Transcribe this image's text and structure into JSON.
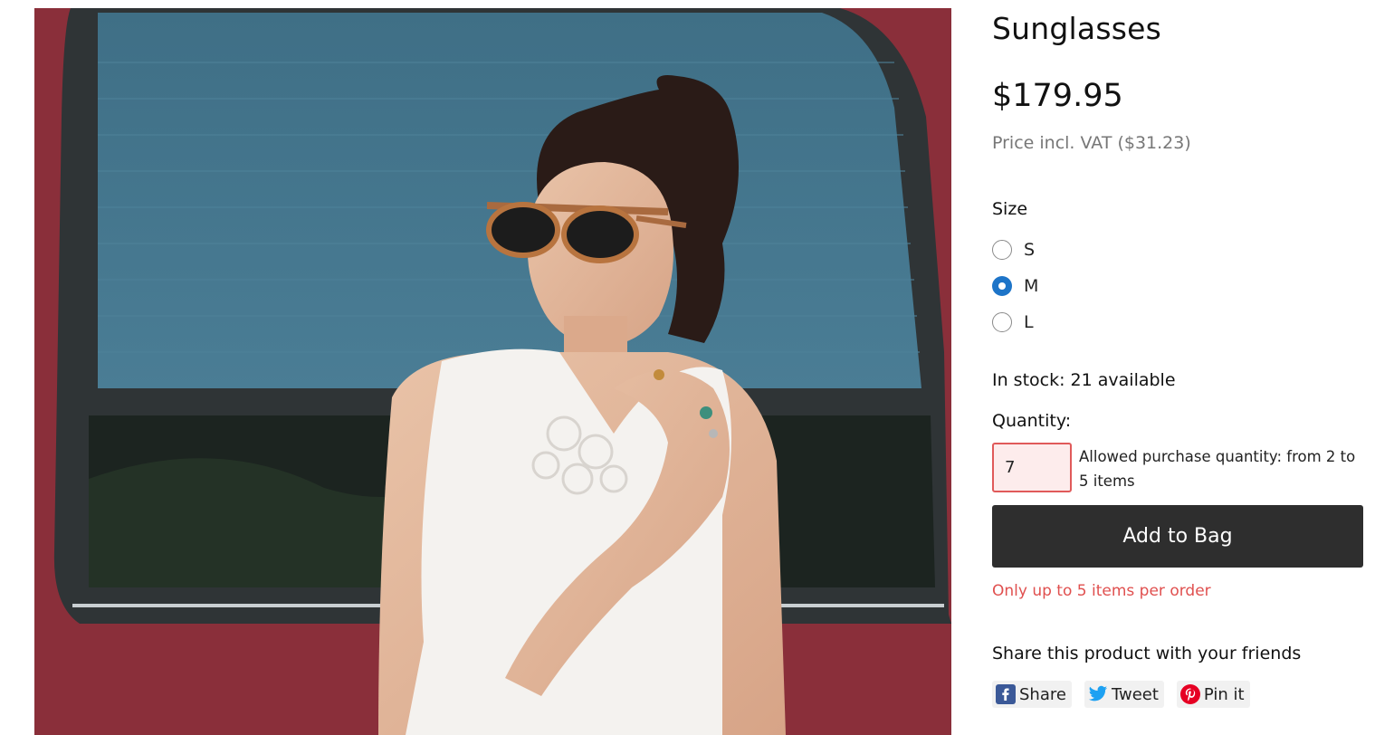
{
  "product": {
    "title": "Sunglasses",
    "price": "$179.95",
    "vat_note": "Price incl. VAT ($31.23)",
    "image_icon": "product-photo-woman-sunglasses"
  },
  "size": {
    "label": "Size",
    "options": [
      {
        "label": "S",
        "selected": false
      },
      {
        "label": "M",
        "selected": true
      },
      {
        "label": "L",
        "selected": false
      }
    ]
  },
  "stock": {
    "text": "In stock: 21 available"
  },
  "quantity": {
    "label": "Quantity:",
    "value": "7",
    "hint": "Allowed purchase quantity: from 2 to 5 items"
  },
  "cart": {
    "add_label": "Add to Bag",
    "error": "Only up to 5 items per order"
  },
  "share": {
    "title": "Share this product with your friends",
    "buttons": [
      {
        "label": "Share",
        "icon": "facebook-icon",
        "color": "#3b5998"
      },
      {
        "label": "Tweet",
        "icon": "twitter-icon",
        "color": "#1da1f2"
      },
      {
        "label": "Pin it",
        "icon": "pinterest-icon",
        "color": "#e60023"
      }
    ]
  },
  "colors": {
    "accent": "#1d74c8",
    "button_bg": "#2e2e2e",
    "error": "#e0504f"
  }
}
